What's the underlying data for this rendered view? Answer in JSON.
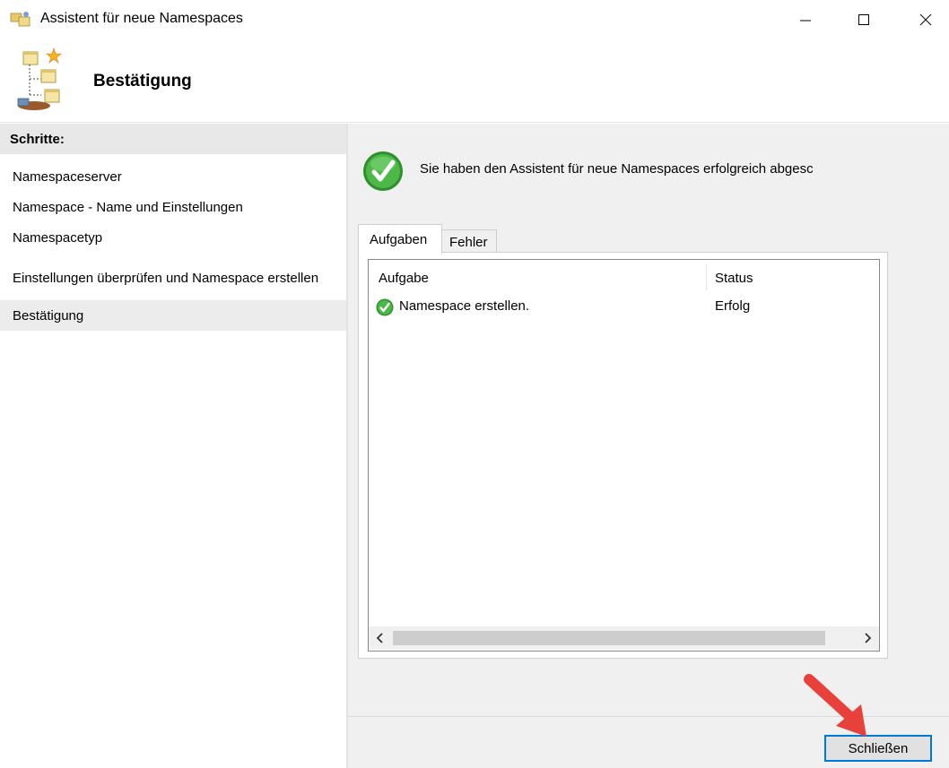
{
  "window": {
    "title": "Assistent für neue Namespaces",
    "controls": {
      "minimize": "—",
      "maximize": "☐",
      "close": "✕"
    }
  },
  "header": {
    "title": "Bestätigung",
    "icon": "namespace-wizard-icon"
  },
  "steps": {
    "heading": "Schritte:",
    "items": [
      {
        "label": "Namespaceserver",
        "active": false
      },
      {
        "label": "Namespace - Name und Einstellungen",
        "active": false
      },
      {
        "label": "Namespacetyp",
        "active": false
      },
      {
        "label": "Einstellungen überprüfen und Namespace erstellen",
        "active": false
      },
      {
        "label": "Bestätigung",
        "active": true
      }
    ]
  },
  "main": {
    "success_message": "Sie haben den Assistent für neue Namespaces erfolgreich abgesc",
    "tabs": [
      {
        "label": "Aufgaben",
        "selected": true
      },
      {
        "label": "Fehler",
        "selected": false
      }
    ],
    "table": {
      "columns": [
        "Aufgabe",
        "Status"
      ],
      "rows": [
        {
          "task": "Namespace erstellen.",
          "status": "Erfolg",
          "icon": "success-check-icon"
        }
      ]
    },
    "scrollbar": {
      "left": "<",
      "right": ">"
    }
  },
  "footer": {
    "close_label": "Schließen"
  },
  "colors": {
    "accent": "#0078d7",
    "success": "#3aa335",
    "arrow": "#e8403a"
  }
}
